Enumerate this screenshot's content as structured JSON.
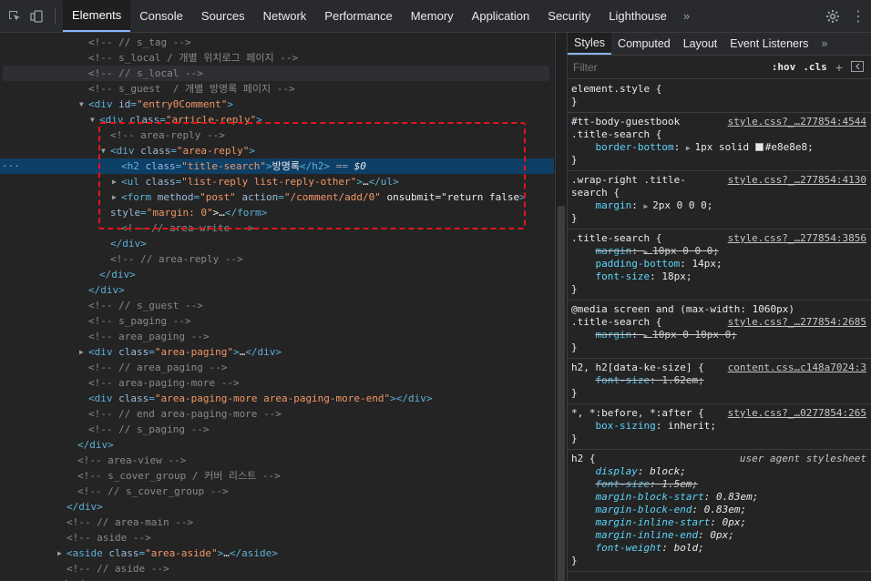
{
  "toolbar": {
    "tabs": [
      "Elements",
      "Console",
      "Sources",
      "Network",
      "Performance",
      "Memory",
      "Application",
      "Security",
      "Lighthouse"
    ],
    "active_tab": "Elements",
    "more": "»"
  },
  "dom_lines": [
    "<!-- // s_tag -->",
    "<!-- s_local / 개별 위치로그 페이지 -->",
    "<!-- // s_local -->",
    "<!-- s_guest  / 개별 방명록 페이지 -->",
    "<div id=\"entry0Comment\">",
    "<div class=\"article-reply\">",
    "<!-- area-reply -->",
    "<div class=\"area-reply\">",
    "<h2 class=\"title-search\">방명록</h2> == $0",
    "<ul class=\"list-reply list-reply-other\">…</ul>",
    "<form method=\"post\" action=\"/comment/add/0\" onsubmit=\"return false\"",
    "style=\"margin: 0\">…</form>",
    "<!-- // area-write -->",
    "</div>",
    "<!-- // area-reply -->",
    "</div>",
    "</div>",
    "<!-- // s_guest -->",
    "<!-- s_paging -->",
    "<!-- area_paging -->",
    "<div class=\"area-paging\">…</div>",
    "<!-- // area_paging -->",
    "<!-- area-paging-more -->",
    "<div class=\"area-paging-more area-paging-more-end\"></div>",
    "<!-- // end area-paging-more -->",
    "<!-- // s_paging -->",
    "</div>",
    "<!-- area-view -->",
    "<!-- s_cover_group / 커버 리스트 -->",
    "<!-- // s_cover_group -->",
    "</div>",
    "<!-- // area-main -->",
    "<!-- aside -->",
    "<aside class=\"area-aside\">…</aside>",
    "<!-- // aside -->",
    "</main>"
  ],
  "styles_panel": {
    "subtabs": [
      "Styles",
      "Computed",
      "Layout",
      "Event Listeners"
    ],
    "active_subtab": "Styles",
    "more": "»",
    "filter_placeholder": "Filter",
    "hov": ":hov",
    "cls": ".cls",
    "rules": [
      {
        "selector": "element.style {",
        "source": "",
        "props": [],
        "close": "}"
      },
      {
        "selector": "#tt-body-guestbook",
        "selector2": ".title-search {",
        "source": "style.css?_…277854:4544",
        "props": [
          {
            "name": "border-bottom",
            "value": "1px solid",
            "value2": "#e8e8e8;",
            "swatch": "#e8e8e8"
          }
        ],
        "close": "}"
      },
      {
        "selector": ".wrap-right .title-",
        "selector2": "search {",
        "source": "style.css?_…277854:4130",
        "props": [
          {
            "name": "margin",
            "value": "2px 0 0 0;"
          }
        ],
        "close": "}"
      },
      {
        "selector": ".title-search {",
        "source": "style.css?_…277854:3856",
        "props": [
          {
            "name": "margin",
            "value": "10px 0 0 0;",
            "struck": true
          },
          {
            "name": "padding-bottom",
            "value": "14px;"
          },
          {
            "name": "font-size",
            "value": "18px;"
          }
        ],
        "close": "}"
      },
      {
        "selector": "@media screen and (max-width: 1060px)",
        "selector2": ".title-search {",
        "source": "style.css?_…277854:2685",
        "props": [
          {
            "name": "margin",
            "value": "10px 0 10px 0;",
            "struck": true
          }
        ],
        "close": "}"
      },
      {
        "selector": "h2, h2[data-ke-size] {",
        "source": "content.css…c148a7024:3",
        "props": [
          {
            "name": "font-size",
            "value": "1.62em;",
            "struck": true
          }
        ],
        "close": "}"
      },
      {
        "selector": "*, *:before, *:after {",
        "source": "style.css?_…0277854:265",
        "props": [
          {
            "name": "box-sizing",
            "value": "inherit;"
          }
        ],
        "close": "}"
      },
      {
        "selector": "h2 {",
        "source": "user agent stylesheet",
        "props": [
          {
            "name": "display",
            "value": "block;"
          },
          {
            "name": "font-size",
            "value": "1.5em;",
            "struck": true
          },
          {
            "name": "margin-block-start",
            "value": "0.83em;"
          },
          {
            "name": "margin-block-end",
            "value": "0.83em;"
          },
          {
            "name": "margin-inline-start",
            "value": "0px;"
          },
          {
            "name": "margin-inline-end",
            "value": "0px;"
          },
          {
            "name": "font-weight",
            "value": "bold;"
          }
        ],
        "close": "}"
      }
    ]
  },
  "colors": {
    "selected_row": "#0e3f66",
    "highlight_box": "#e3151b",
    "accent": "#8ab4f8"
  }
}
